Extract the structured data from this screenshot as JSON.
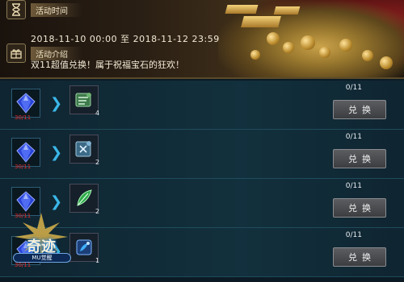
{
  "banner": {
    "time_label": "活动时间",
    "time_value": "2018-11-10  00:00     至  2018-11-12  23:59",
    "intro_label": "活动介绍",
    "intro_value": "双11超值兑换！属于祝福宝石的狂欢！"
  },
  "rows": [
    {
      "gem_count": "30/11",
      "item_icon": "scroll-icon",
      "item_count": "4",
      "progress": "0/11",
      "button": "兑换"
    },
    {
      "gem_count": "30/11",
      "item_icon": "rune-icon",
      "item_count": "2",
      "progress": "0/11",
      "button": "兑换"
    },
    {
      "gem_count": "30/11",
      "item_icon": "feather-icon",
      "item_count": "2",
      "progress": "0/11",
      "button": "兑换"
    },
    {
      "gem_count": "30/11",
      "item_icon": "tome-icon",
      "item_count": "1",
      "progress": "0/11",
      "button": "兑换"
    }
  ],
  "logo": {
    "title": "奇迹",
    "subtitle": "MU觉醒"
  },
  "colors": {
    "accent_arrow": "#3ab7e8",
    "gem_count": "#e22c2c"
  }
}
